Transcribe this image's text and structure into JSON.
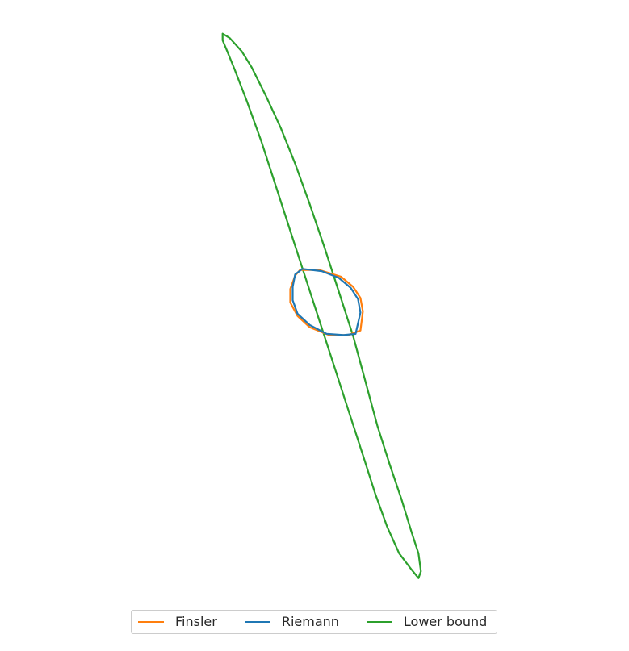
{
  "chart_data": {
    "type": "line",
    "title": "",
    "xlabel": "",
    "ylabel": "",
    "axes_visible": false,
    "grid": false,
    "legend_placement": "bottom-center",
    "xlim": [
      -1.25,
      1.25
    ],
    "ylim": [
      -1.35,
      1.35
    ],
    "series": [
      {
        "name": "Finsler",
        "color": "#ff7f0e",
        "x": [
          -0.06,
          0.02,
          0.11,
          0.16,
          0.19,
          0.2,
          0.19,
          0.14,
          0.06,
          -0.02,
          -0.07,
          -0.1,
          -0.1,
          -0.08,
          -0.06
        ],
        "y": [
          0.145,
          0.145,
          0.115,
          0.07,
          0.02,
          -0.04,
          -0.125,
          -0.145,
          -0.145,
          -0.11,
          -0.06,
          -0.0,
          0.06,
          0.12,
          0.145
        ]
      },
      {
        "name": "Riemann",
        "color": "#1f77b4",
        "x": [
          -0.05,
          0.03,
          0.1,
          0.15,
          0.18,
          0.19,
          0.17,
          0.12,
          0.05,
          -0.02,
          -0.07,
          -0.09,
          -0.09,
          -0.08,
          -0.05
        ],
        "y": [
          0.15,
          0.14,
          0.11,
          0.065,
          0.015,
          -0.045,
          -0.14,
          -0.145,
          -0.14,
          -0.1,
          -0.05,
          0.01,
          0.07,
          0.125,
          0.15
        ]
      },
      {
        "name": "Lower bound",
        "color": "#2ca02c",
        "x": [
          -0.38,
          -0.35,
          -0.3,
          -0.26,
          -0.2,
          -0.14,
          -0.08,
          -0.02,
          0.04,
          0.1,
          0.16,
          0.21,
          0.26,
          0.31,
          0.36,
          0.4,
          0.43,
          0.44,
          0.43,
          0.4,
          0.35,
          0.3,
          0.25,
          0.2,
          0.14,
          0.08,
          0.02,
          -0.04,
          -0.1,
          -0.16,
          -0.22,
          -0.28,
          -0.33,
          -0.36,
          -0.38,
          -0.38
        ],
        "y": [
          1.2,
          1.18,
          1.12,
          1.05,
          0.92,
          0.78,
          0.62,
          0.44,
          0.25,
          0.05,
          -0.15,
          -0.35,
          -0.55,
          -0.72,
          -0.88,
          -1.02,
          -1.12,
          -1.2,
          -1.23,
          -1.19,
          -1.12,
          -1.0,
          -0.85,
          -0.68,
          -0.48,
          -0.28,
          -0.08,
          0.12,
          0.32,
          0.52,
          0.72,
          0.9,
          1.04,
          1.12,
          1.17,
          1.2
        ]
      }
    ]
  }
}
